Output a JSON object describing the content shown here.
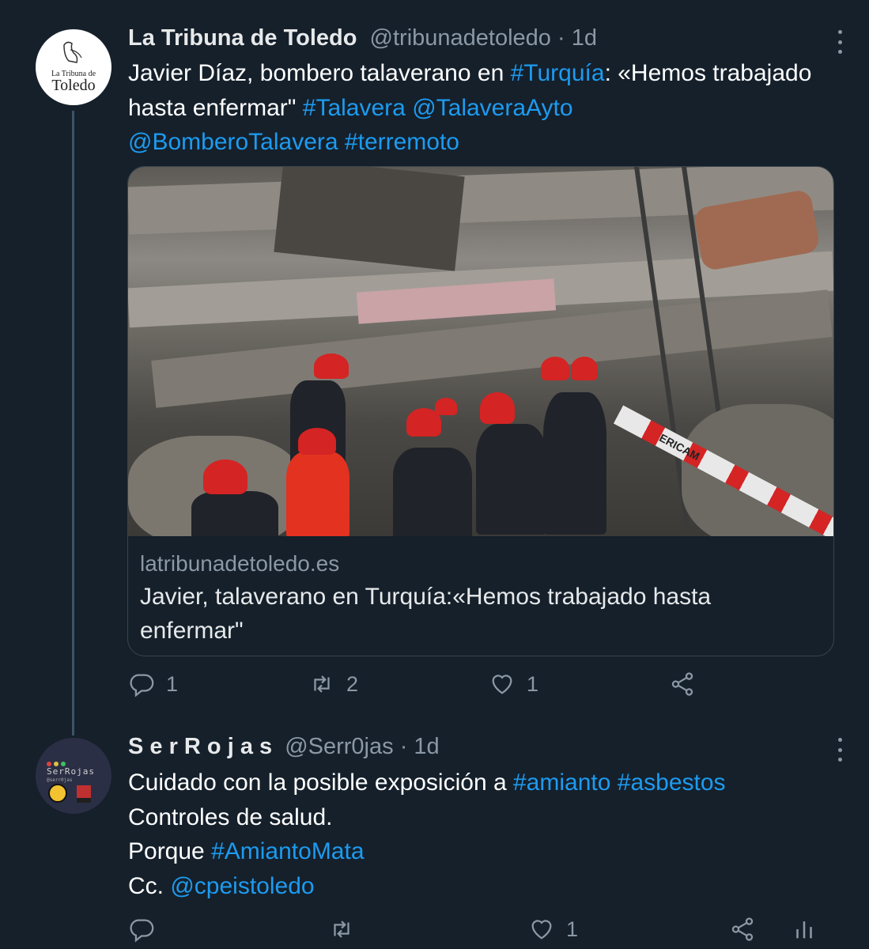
{
  "tweets": [
    {
      "author_name": "La Tribuna de Toledo",
      "handle": "@tribunadetoledo",
      "separator": " · ",
      "time": "1d",
      "avatar_text_top": "La Tribuna de",
      "avatar_text_bottom": "Toledo",
      "text": [
        {
          "t": "Javier Díaz, bombero talaverano en ",
          "link": false
        },
        {
          "t": "#Turquía",
          "link": true
        },
        {
          "t": ": «Hemos trabajado hasta enfermar\" ",
          "link": false
        },
        {
          "t": "#Talavera",
          "link": true
        },
        {
          "t": " ",
          "link": false
        },
        {
          "t": "@TalaveraAyto",
          "link": true
        },
        {
          "t": " ",
          "link": false
        },
        {
          "t": "@BomberoTalavera",
          "link": true
        },
        {
          "t": " ",
          "link": false
        },
        {
          "t": "#terremoto",
          "link": true
        }
      ],
      "card": {
        "domain": "latribunadetoledo.es",
        "title": "Javier, talaverano en Turquía:«Hemos trabajado hasta enfermar\"",
        "image_alt": "rescue workers in red helmets searching collapsed building rubble",
        "tape_text": "ERICAM"
      },
      "actions": {
        "reply_icon": "reply-icon",
        "reply_count": "1",
        "retweet_icon": "retweet-icon",
        "retweet_count": "2",
        "like_icon": "heart-icon",
        "like_count": "1",
        "share_icon": "share-icon"
      }
    },
    {
      "author_name": "S e r R o j a s",
      "handle": "@Serr0jas",
      "separator": " · ",
      "time": "1d",
      "avatar_text_top": "SerRojas",
      "avatar_text_bottom": "@serr0jas",
      "lines": [
        [
          {
            "t": "Cuidado con la posible exposición a ",
            "link": false
          },
          {
            "t": "#amianto",
            "link": true
          },
          {
            "t": " ",
            "link": false
          },
          {
            "t": "#asbestos",
            "link": true
          }
        ],
        [
          {
            "t": "Controles de salud.",
            "link": false
          }
        ],
        [
          {
            "t": "Porque ",
            "link": false
          },
          {
            "t": "#AmiantoMata",
            "link": true
          }
        ],
        [
          {
            "t": "Cc. ",
            "link": false
          },
          {
            "t": "@cpeistoledo",
            "link": true
          }
        ]
      ],
      "actions": {
        "reply_icon": "reply-icon",
        "reply_count": "",
        "retweet_icon": "retweet-icon",
        "retweet_count": "",
        "like_icon": "heart-icon",
        "like_count": "1",
        "share_icon": "share-icon",
        "analytics_icon": "analytics-icon"
      }
    }
  ],
  "colors": {
    "background": "#15202b",
    "link": "#1d9bf0",
    "muted": "#8b98a5",
    "border": "#38444d"
  }
}
